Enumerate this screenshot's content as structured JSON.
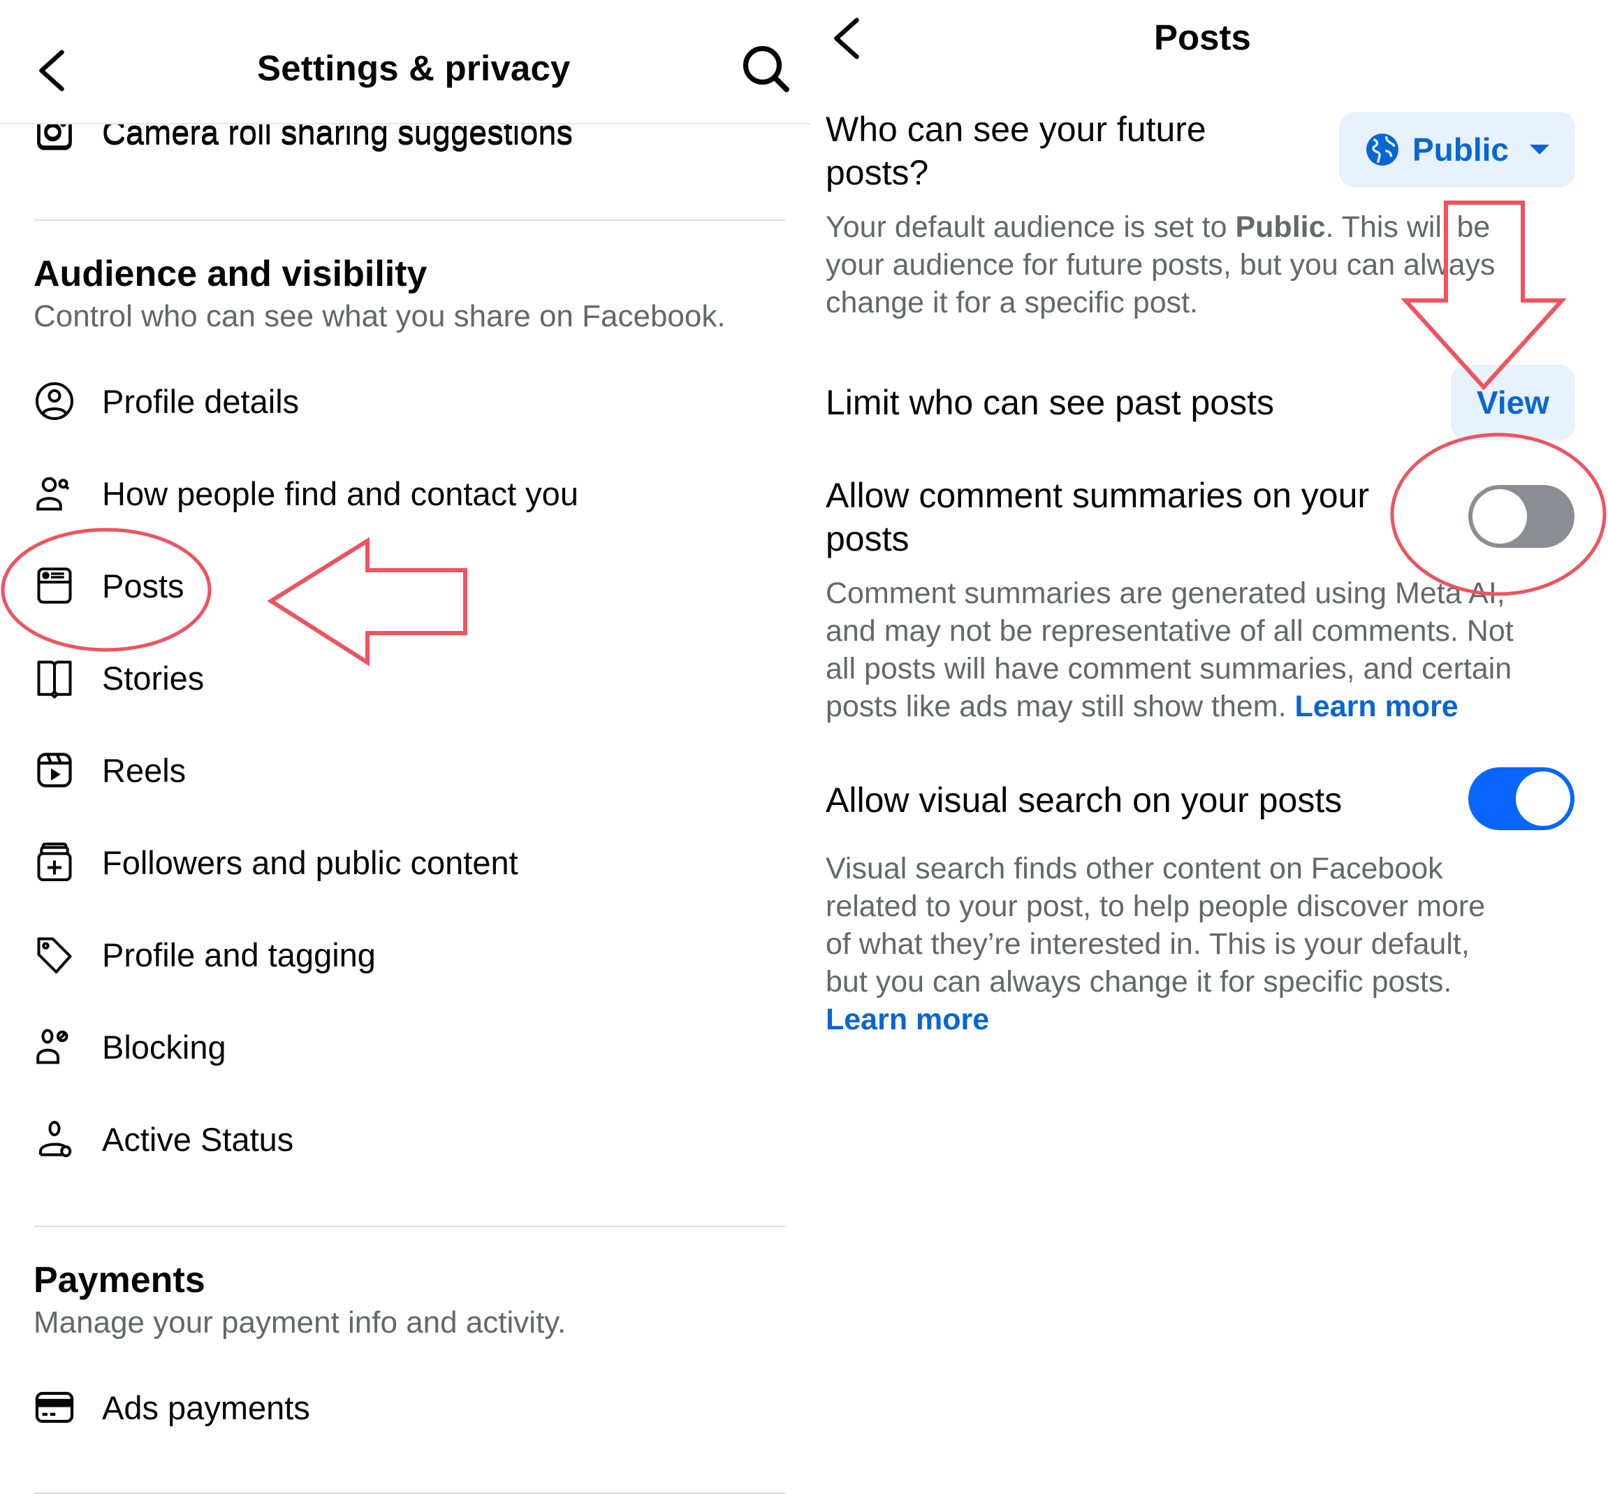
{
  "left_screen": {
    "header": {
      "title": "Settings & privacy",
      "back_icon": "chevron-left-icon",
      "search_icon": "search-icon"
    },
    "partial_item": {
      "label": "Camera roll sharing suggestions",
      "icon": "camera-icon"
    },
    "sections": [
      {
        "title": "Audience and visibility",
        "subtitle": "Control who can see what you share on Facebook.",
        "items": [
          {
            "label": "Profile details",
            "icon": "profile-circle-icon"
          },
          {
            "label": "How people find and contact you",
            "icon": "person-search-icon"
          },
          {
            "label": "Posts",
            "icon": "posts-icon"
          },
          {
            "label": "Stories",
            "icon": "book-icon"
          },
          {
            "label": "Reels",
            "icon": "reels-icon"
          },
          {
            "label": "Followers and public content",
            "icon": "followers-icon"
          },
          {
            "label": "Profile and tagging",
            "icon": "tag-icon"
          },
          {
            "label": "Blocking",
            "icon": "person-block-icon"
          },
          {
            "label": "Active Status",
            "icon": "person-status-icon"
          }
        ]
      },
      {
        "title": "Payments",
        "subtitle": "Manage your payment info and activity.",
        "items": [
          {
            "label": "Ads payments",
            "icon": "credit-card-icon"
          }
        ]
      }
    ]
  },
  "right_screen": {
    "header": {
      "title": "Posts",
      "back_icon": "chevron-left-icon"
    },
    "future_posts": {
      "heading_line1": "Who can see your future",
      "heading_line2": "posts?",
      "audience_button": {
        "label": "Public",
        "icon": "globe-icon"
      },
      "desc_prefix": "Your default audience is set to ",
      "desc_bold": "Public",
      "desc_line1_rest": ". This will be",
      "desc_line2": "your audience for future posts, but you can always",
      "desc_line3": "change it for a specific post."
    },
    "past_posts": {
      "heading": "Limit who can see past posts",
      "button_label": "View"
    },
    "comment_summaries": {
      "heading_line1": "Allow comment summaries on your",
      "heading_line2": "posts",
      "enabled": false,
      "desc_lines": [
        "Comment summaries are generated using Meta AI,",
        "and may not be representative of all comments. Not",
        "all posts will have comment summaries, and certain"
      ],
      "desc_last": "posts like ads may still show them. ",
      "learn_more": "Learn more"
    },
    "visual_search": {
      "heading": "Allow visual search on your posts",
      "enabled": true,
      "desc_lines": [
        "Visual search finds other content on Facebook",
        "related to your post, to help people discover more",
        "of what they’re interested in. This is your default,",
        "but you can always change it for specific posts."
      ],
      "learn_more": "Learn more"
    }
  },
  "annotations": {
    "color": "#f0525e",
    "marks": [
      "circle-around-posts-item",
      "arrow-pointing-left-to-posts",
      "arrow-pointing-down-to-view",
      "circle-around-comment-summary-toggle"
    ]
  },
  "colors": {
    "accent_blue": "#0866d4",
    "toggle_on": "#0866ff",
    "toggle_off": "#8a8d91",
    "pill_bg": "#e7f2fe",
    "secondary_text": "#65676b"
  }
}
